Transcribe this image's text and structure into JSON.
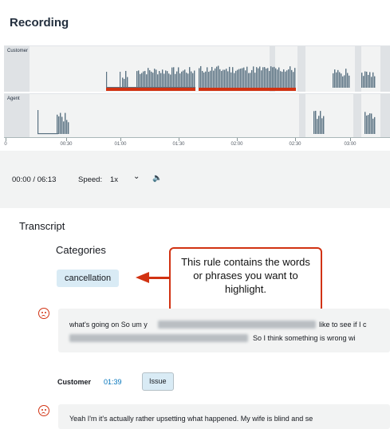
{
  "recording": {
    "title": "Recording",
    "tracks": {
      "customer_label": "Customer",
      "agent_label": "Agent"
    },
    "timeline_ticks": [
      "0",
      "00:30",
      "01:00",
      "01:30",
      "02:00",
      "02:30",
      "03:00"
    ],
    "playback": {
      "position": "00:00 / 06:13",
      "speed_label": "Speed:",
      "speed_value": "1x",
      "dropdown_glyph": "⌄",
      "volume_glyph": "🔈"
    }
  },
  "transcript": {
    "title": "Transcript",
    "categories_title": "Categories",
    "category": "cancellation",
    "callout": "This rule contains the words or phrases you want to highlight.",
    "messages": [
      {
        "line1_a": "what's going on So um y",
        "line1_b": "like to see if I c",
        "line2_b": "So I think something is wrong wi"
      },
      {
        "speaker": "Customer",
        "time": "01:39",
        "badge": "Issue",
        "line1": "Yeah I'm it's actually rather upsetting what happened. My wife is blind and se"
      }
    ]
  },
  "colors": {
    "accent": "#d13212",
    "waveform": "#5a7282",
    "link": "#0073bb",
    "badge": "#d9ebf5"
  },
  "icons": [
    "sad-face-icon",
    "volume-icon",
    "chevron-down-icon"
  ]
}
